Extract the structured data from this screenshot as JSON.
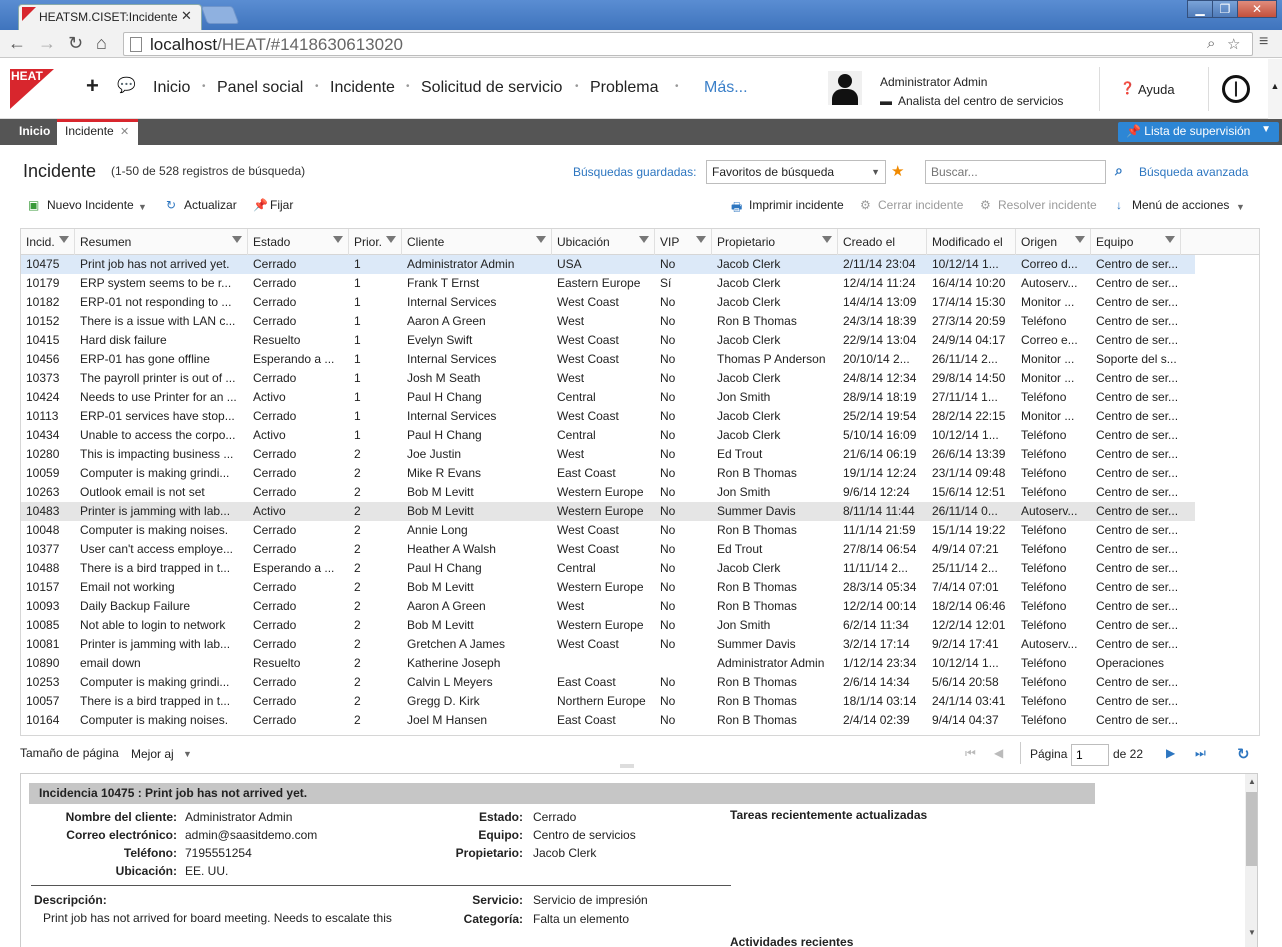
{
  "browser": {
    "tab_title": "HEATSM.CISET:Incidente",
    "url_host": "localhost",
    "url_path": "/HEAT/#1418630613020"
  },
  "nav": {
    "items": [
      "Inicio",
      "Panel social",
      "Incidente",
      "Solicitud de servicio",
      "Problema"
    ],
    "more": "Más...",
    "logo_text": "HEAT"
  },
  "user": {
    "name": "Administrator Admin",
    "role": "Analista del centro de servicios",
    "help": "Ayuda"
  },
  "tabs": {
    "home": "Inicio",
    "active": "Incidente",
    "watch_list": "Lista de supervisión"
  },
  "list": {
    "title": "Incidente",
    "count": "(1-50 de 528 registros de búsqueda)",
    "saved_label": "Búsquedas guardadas:",
    "saved_value": "Favoritos de búsqueda",
    "search_placeholder": "Buscar...",
    "advanced": "Búsqueda avanzada"
  },
  "toolbar": {
    "new": "Nuevo Incidente",
    "refresh": "Actualizar",
    "pin": "Fijar",
    "print": "Imprimir incidente",
    "close": "Cerrar incidente",
    "resolve": "Resolver incidente",
    "actions": "Menú de acciones"
  },
  "columns": [
    "Incid.",
    "Resumen",
    "Estado",
    "Prior.",
    "Cliente",
    "Ubicación",
    "VIP",
    "Propietario",
    "Creado el",
    "Modificado el",
    "Origen",
    "Equipo"
  ],
  "rows": [
    [
      "10475",
      "Print job has not arrived yet.",
      "Cerrado",
      "1",
      "Administrator Admin",
      "USA",
      "No",
      "Jacob Clerk",
      "2/11/14 23:04",
      "10/12/14 1...",
      "Correo d...",
      "Centro de ser..."
    ],
    [
      "10179",
      "ERP system seems to be r...",
      "Cerrado",
      "1",
      "Frank T Ernst",
      "Eastern Europe",
      "Sí",
      "Jacob Clerk",
      "12/4/14 11:24",
      "16/4/14 10:20",
      "Autoserv...",
      "Centro de ser..."
    ],
    [
      "10182",
      "ERP-01 not responding to ...",
      "Cerrado",
      "1",
      "Internal Services",
      "West Coast",
      "No",
      "Jacob Clerk",
      "14/4/14 13:09",
      "17/4/14 15:30",
      "Monitor ...",
      "Centro de ser..."
    ],
    [
      "10152",
      "There is a issue with LAN c...",
      "Cerrado",
      "1",
      "Aaron A Green",
      "West",
      "No",
      "Ron B Thomas",
      "24/3/14 18:39",
      "27/3/14 20:59",
      "Teléfono",
      "Centro de ser..."
    ],
    [
      "10415",
      "Hard disk failure",
      "Resuelto",
      "1",
      "Evelyn Swift",
      "West Coast",
      "No",
      "Jacob Clerk",
      "22/9/14 13:04",
      "24/9/14 04:17",
      "Correo e...",
      "Centro de ser..."
    ],
    [
      "10456",
      "ERP-01 has gone offline",
      "Esperando a ...",
      "1",
      "Internal Services",
      "West Coast",
      "No",
      "Thomas P Anderson",
      "20/10/14 2...",
      "26/11/14 2...",
      "Monitor ...",
      "Soporte del s..."
    ],
    [
      "10373",
      "The payroll printer is out of ...",
      "Cerrado",
      "1",
      "Josh M Seath",
      "West",
      "No",
      "Jacob Clerk",
      "24/8/14 12:34",
      "29/8/14 14:50",
      "Monitor ...",
      "Centro de ser..."
    ],
    [
      "10424",
      "Needs to use Printer for an ...",
      "Activo",
      "1",
      "Paul H Chang",
      "Central",
      "No",
      "Jon Smith",
      "28/9/14 18:19",
      "27/11/14 1...",
      "Teléfono",
      "Centro de ser..."
    ],
    [
      "10113",
      "ERP-01 services have stop...",
      "Cerrado",
      "1",
      "Internal Services",
      "West Coast",
      "No",
      "Jacob Clerk",
      "25/2/14 19:54",
      "28/2/14 22:15",
      "Monitor ...",
      "Centro de ser..."
    ],
    [
      "10434",
      "Unable to access the corpo...",
      "Activo",
      "1",
      "Paul H Chang",
      "Central",
      "No",
      "Jacob Clerk",
      "5/10/14 16:09",
      "10/12/14 1...",
      "Teléfono",
      "Centro de ser..."
    ],
    [
      "10280",
      "This is impacting business ...",
      "Cerrado",
      "2",
      "Joe Justin",
      "West",
      "No",
      "Ed Trout",
      "21/6/14 06:19",
      "26/6/14 13:39",
      "Teléfono",
      "Centro de ser..."
    ],
    [
      "10059",
      "Computer is making grindi...",
      "Cerrado",
      "2",
      "Mike R Evans",
      "East Coast",
      "No",
      "Ron B Thomas",
      "19/1/14 12:24",
      "23/1/14 09:48",
      "Teléfono",
      "Centro de ser..."
    ],
    [
      "10263",
      "Outlook email is not set",
      "Cerrado",
      "2",
      "Bob M Levitt",
      "Western Europe",
      "No",
      "Jon Smith",
      "9/6/14 12:24",
      "15/6/14 12:51",
      "Teléfono",
      "Centro de ser..."
    ],
    [
      "10483",
      "Printer is jamming with lab...",
      "Activo",
      "2",
      "Bob M Levitt",
      "Western Europe",
      "No",
      "Summer Davis",
      "8/11/14 11:44",
      "26/11/14 0...",
      "Autoserv...",
      "Centro de ser..."
    ],
    [
      "10048",
      "Computer is making noises.",
      "Cerrado",
      "2",
      "Annie Long",
      "West Coast",
      "No",
      "Ron B Thomas",
      "11/1/14 21:59",
      "15/1/14 19:22",
      "Teléfono",
      "Centro de ser..."
    ],
    [
      "10377",
      "User can't access employe...",
      "Cerrado",
      "2",
      "Heather A Walsh",
      "West Coast",
      "No",
      "Ed Trout",
      "27/8/14 06:54",
      "4/9/14 07:21",
      "Teléfono",
      "Centro de ser..."
    ],
    [
      "10488",
      "There is a bird trapped in t...",
      "Esperando a ...",
      "2",
      "Paul H Chang",
      "Central",
      "No",
      "Jacob Clerk",
      "11/11/14 2...",
      "25/11/14 2...",
      "Teléfono",
      "Centro de ser..."
    ],
    [
      "10157",
      "Email not working",
      "Cerrado",
      "2",
      "Bob M Levitt",
      "Western Europe",
      "No",
      "Ron B Thomas",
      "28/3/14 05:34",
      "7/4/14 07:01",
      "Teléfono",
      "Centro de ser..."
    ],
    [
      "10093",
      "Daily Backup Failure",
      "Cerrado",
      "2",
      "Aaron A Green",
      "West",
      "No",
      "Ron B Thomas",
      "12/2/14 00:14",
      "18/2/14 06:46",
      "Teléfono",
      "Centro de ser..."
    ],
    [
      "10085",
      "Not able to login to network",
      "Cerrado",
      "2",
      "Bob M Levitt",
      "Western Europe",
      "No",
      "Jon Smith",
      "6/2/14 11:34",
      "12/2/14 12:01",
      "Teléfono",
      "Centro de ser..."
    ],
    [
      "10081",
      "Printer is jamming with lab...",
      "Cerrado",
      "2",
      "Gretchen A James",
      "West Coast",
      "No",
      "Summer Davis",
      "3/2/14 17:14",
      "9/2/14 17:41",
      "Autoserv...",
      "Centro de ser..."
    ],
    [
      "10890",
      "email down",
      "Resuelto",
      "2",
      "Katherine Joseph",
      "",
      "",
      "Administrator Admin",
      "1/12/14 23:34",
      "10/12/14 1...",
      "Teléfono",
      "Operaciones"
    ],
    [
      "10253",
      "Computer is making grindi...",
      "Cerrado",
      "2",
      "Calvin L Meyers",
      "East Coast",
      "No",
      "Ron B Thomas",
      "2/6/14 14:34",
      "5/6/14 20:58",
      "Teléfono",
      "Centro de ser..."
    ],
    [
      "10057",
      "There is a bird trapped in t...",
      "Cerrado",
      "2",
      "Gregg D. Kirk",
      "Northern Europe",
      "No",
      "Ron B Thomas",
      "18/1/14 03:14",
      "24/1/14 03:41",
      "Teléfono",
      "Centro de ser..."
    ],
    [
      "10164",
      "Computer is making noises.",
      "Cerrado",
      "2",
      "Joel M Hansen",
      "East Coast",
      "No",
      "Ron B Thomas",
      "2/4/14 02:39",
      "9/4/14 04:37",
      "Teléfono",
      "Centro de ser..."
    ]
  ],
  "pager": {
    "page_size_label": "Tamaño de página",
    "page_size_value": "Mejor aj",
    "page_label": "Página",
    "page_value": "1",
    "of_label": "de 22"
  },
  "detail": {
    "title": "Incidencia 10475 : Print job has not arrived yet.",
    "fields": [
      {
        "label": "Nombre del cliente:",
        "value": "Administrator Admin"
      },
      {
        "label": "Correo electrónico:",
        "value": "admin@saasitdemo.com"
      },
      {
        "label": "Teléfono:",
        "value": "7195551254"
      },
      {
        "label": "Ubicación:",
        "value": "EE. UU."
      }
    ],
    "fields_right": [
      {
        "label": "Estado:",
        "value": "Cerrado"
      },
      {
        "label": "Equipo:",
        "value": "Centro de servicios"
      },
      {
        "label": "Propietario:",
        "value": "Jacob Clerk"
      }
    ],
    "description_label": "Descripción:",
    "description": "Print job has not arrived for board meeting.  Needs to escalate this",
    "service_label": "Servicio:",
    "service": "Servicio de impresión",
    "category_label": "Categoría:",
    "category": "Falta un elemento",
    "tasks_title": "Tareas recientemente actualizadas",
    "activities_title": "Actividades recientes"
  },
  "colors": {
    "accent": "#2d86d5",
    "brand": "#d8262d",
    "link": "#2d76c0"
  }
}
